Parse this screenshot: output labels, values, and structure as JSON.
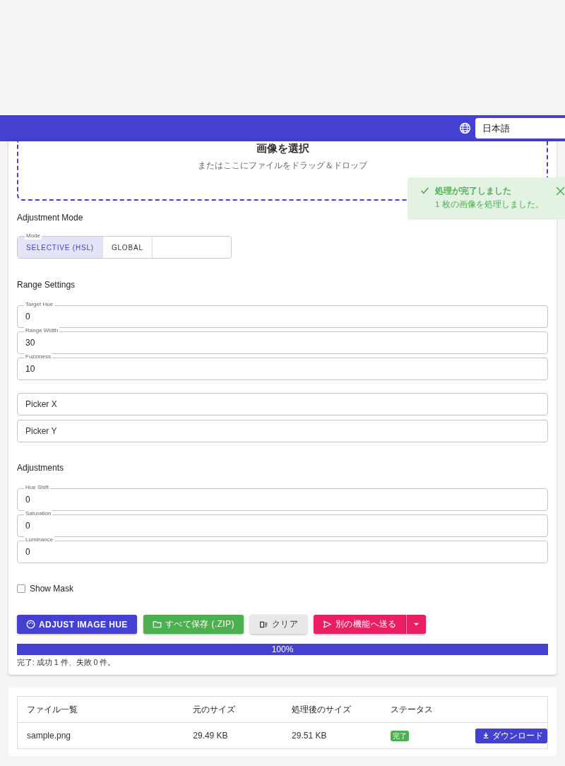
{
  "header": {
    "language": "日本語"
  },
  "dropzone": {
    "title": "画像を選択",
    "hint": "またはここにファイルをドラッグ＆ドロップ"
  },
  "toast": {
    "title": "処理が完了しました",
    "message": "1 枚の画像を処理しました。"
  },
  "mode_section": {
    "heading": "Adjustment Mode",
    "label": "Mode",
    "options": [
      {
        "label": "SELECTIVE (HSL)",
        "selected": true
      },
      {
        "label": "GLOBAL",
        "selected": false
      }
    ]
  },
  "range_section": {
    "heading": "Range Settings",
    "fields": [
      {
        "label": "Target Hue",
        "value": "0"
      },
      {
        "label": "Range Width",
        "value": "30"
      },
      {
        "label": "Fuzziness",
        "value": "10"
      }
    ]
  },
  "picker_fields": [
    {
      "placeholder": "Picker X"
    },
    {
      "placeholder": "Picker Y"
    }
  ],
  "adjustments": {
    "heading": "Adjustments",
    "fields": [
      {
        "label": "Hue Shift",
        "value": "0"
      },
      {
        "label": "Saturation",
        "value": "0"
      },
      {
        "label": "Luminance",
        "value": "0"
      }
    ]
  },
  "show_mask": {
    "label": "Show Mask",
    "checked": false
  },
  "buttons": [
    {
      "kind": "primary",
      "label": "ADJUST IMAGE HUE"
    },
    {
      "kind": "save",
      "label": "すべて保存 (.ZIP)"
    },
    {
      "kind": "clear",
      "label": "クリア"
    },
    {
      "kind": "send",
      "label": "別の機能へ送る"
    }
  ],
  "progress": {
    "level": 1,
    "reading": "100%"
  },
  "summary": "完了: 成功 1 件、失敗 0 件。",
  "table": {
    "columns": [
      "ファイル一覧",
      "元のサイズ",
      "処理後のサイズ",
      "ステータス"
    ],
    "rows": [
      {
        "name": "sample.png",
        "original_size": "29.49 KB",
        "processed_size": "29.51 KB",
        "status": "完了",
        "action": "ダウンロード"
      }
    ]
  }
}
